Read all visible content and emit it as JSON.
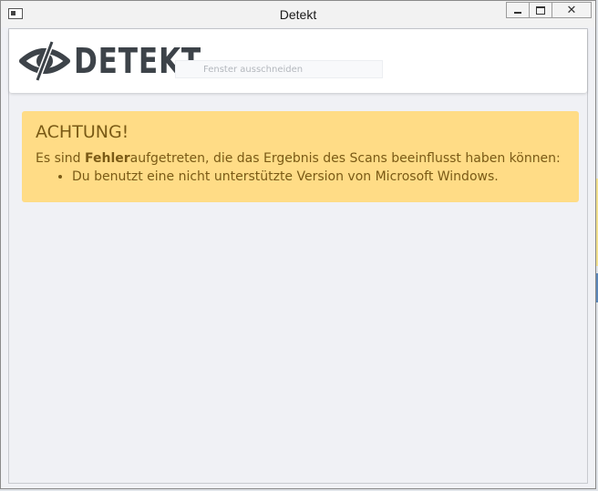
{
  "window": {
    "title": "Detekt",
    "controls": {
      "minimize": "minimize",
      "maximize": "maximize",
      "close": "✕"
    }
  },
  "header": {
    "logo_text": "DETEKT",
    "search_placeholder": "Fenster ausschneiden"
  },
  "alert": {
    "title": "ACHTUNG!",
    "message_prefix": "Es sind ",
    "message_bold": "Fehler",
    "message_suffix": "aufgetreten, die das Ergebnis des Scans beeinflusst haben können:",
    "items": [
      "Du benutzt eine nicht unterstützte Version von Microsoft Windows."
    ],
    "colors": {
      "background": "#ffdc86",
      "text": "#7a5a15"
    }
  },
  "icons": [
    "app-icon",
    "eye-logo-icon",
    "minimize-icon",
    "maximize-icon",
    "close-icon"
  ]
}
